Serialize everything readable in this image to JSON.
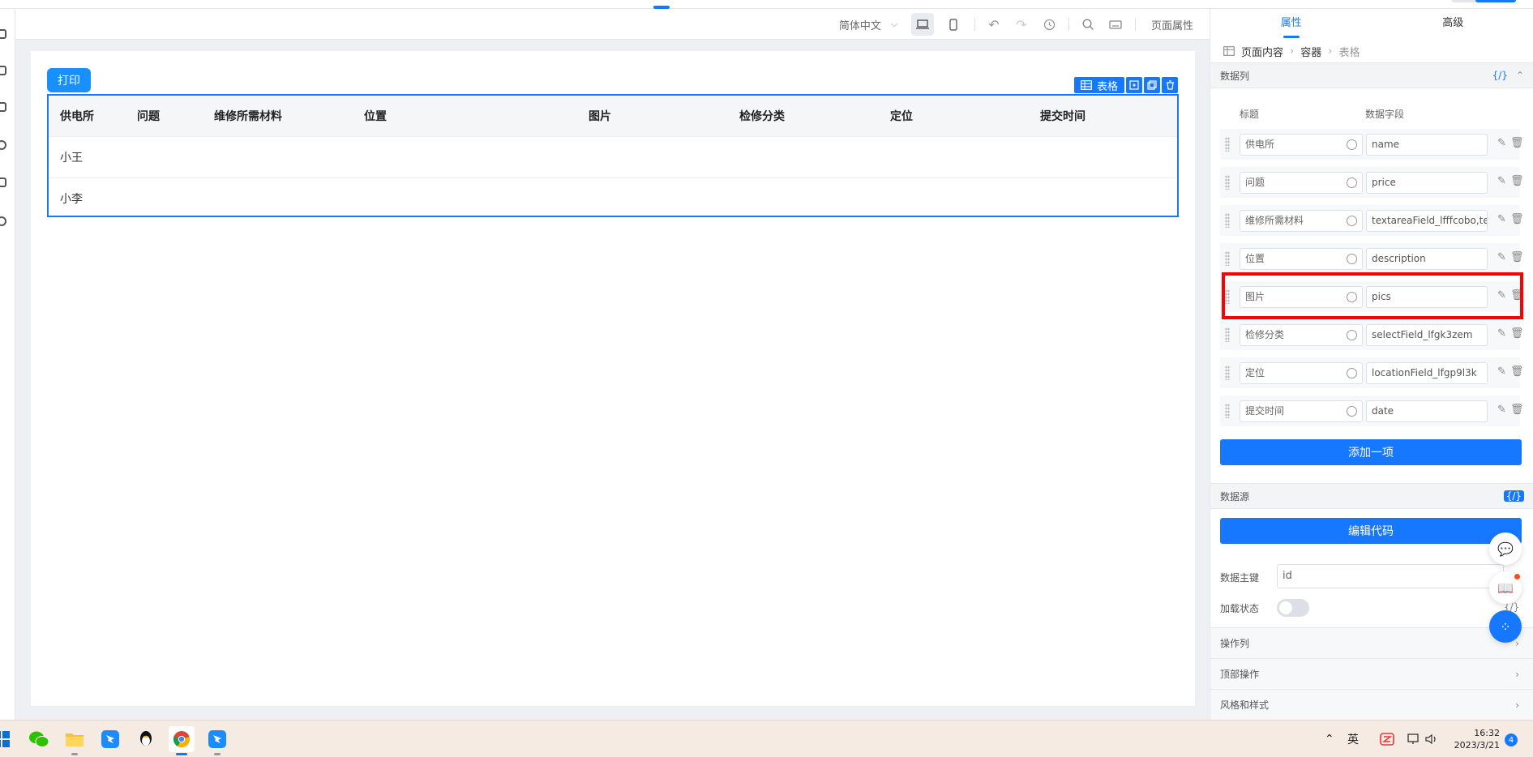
{
  "toolbar": {
    "language": "简体中文",
    "page_props": "页面属性"
  },
  "canvas": {
    "print_button": "打印",
    "table_tag": "表格"
  },
  "table": {
    "columns": [
      "供电所",
      "问题",
      "维修所需材料",
      "位置",
      "图片",
      "检修分类",
      "定位",
      "提交时间"
    ],
    "rows": [
      [
        "小王",
        "",
        "",
        "",
        "",
        "",
        "",
        ""
      ],
      [
        "小李",
        "",
        "",
        "",
        "",
        "",
        "",
        ""
      ]
    ]
  },
  "panel": {
    "tabs": [
      "属性",
      "高级"
    ],
    "breadcrumb": [
      "页面内容",
      "容器",
      "表格"
    ],
    "data_columns_label": "数据列",
    "code_symbol": "{/}",
    "col_title_header": "标题",
    "col_field_header": "数据字段",
    "fields": [
      {
        "title": "供电所",
        "field": "name"
      },
      {
        "title": "问题",
        "field": "price"
      },
      {
        "title": "维修所需材料",
        "field": "textareaField_lfffcobo,te"
      },
      {
        "title": "位置",
        "field": "description"
      },
      {
        "title": "图片",
        "field": "pics"
      },
      {
        "title": "检修分类",
        "field": "selectField_lfgk3zem"
      },
      {
        "title": "定位",
        "field": "locationField_lfgp9l3k"
      },
      {
        "title": "提交时间",
        "field": "date"
      }
    ],
    "add_item": "添加一项",
    "data_source_label": "数据源",
    "edit_code": "编辑代码",
    "primary_key_label": "数据主键",
    "primary_key_value": "id",
    "loading_state_label": "加载状态",
    "sections": [
      "操作列",
      "顶部操作",
      "风格和样式"
    ]
  },
  "taskbar": {
    "ime": "英",
    "time": "16:32",
    "date": "2023/3/21",
    "notifications": "4"
  }
}
